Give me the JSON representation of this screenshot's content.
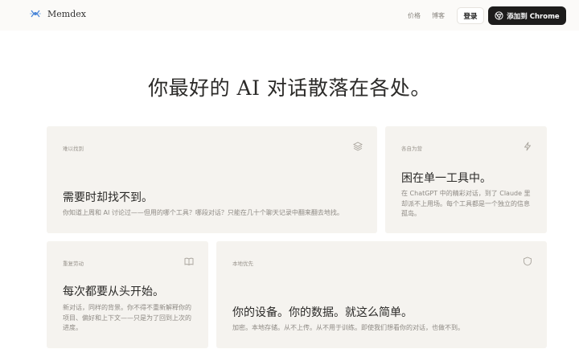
{
  "header": {
    "brand": "Memdex",
    "nav": {
      "pricing": "价格",
      "blog": "博客"
    },
    "login_label": "登录",
    "chrome_label": "添加到 Chrome"
  },
  "hero": {
    "title": "你最好的 AI 对话散落在各处。"
  },
  "cards": [
    {
      "tag": "难以找到",
      "icon": "layers-icon",
      "title": "需要时却找不到。",
      "desc": "你知道上周和 AI 讨论过——但用的哪个工具？哪段对话？只能在几十个聊天记录中翻来翻去地找。"
    },
    {
      "tag": "各自为营",
      "icon": "lightning-icon",
      "title": "困在单一工具中。",
      "desc": "在 ChatGPT 中的精彩对话，到了 Claude 里却派不上用场。每个工具都是一个独立的信息孤岛。"
    },
    {
      "tag": "重复劳动",
      "icon": "book-icon",
      "title": "每次都要从头开始。",
      "desc": "新对话，同样的背景。你不得不重新解释你的项目、偏好和上下文——只是为了回到上次的进度。"
    },
    {
      "tag": "本地优先",
      "icon": "shield-icon",
      "title": "你的设备。你的数据。就这么简单。",
      "desc": "加密。本地存储。从不上传。从不用于训练。即使我们想看你的对话，也做不到。"
    }
  ],
  "colors": {
    "background": "#ffffff",
    "card_bg": "#f5f3ef",
    "primary_button": "#1d1c1b",
    "logo_accent": "#4a86d8"
  }
}
